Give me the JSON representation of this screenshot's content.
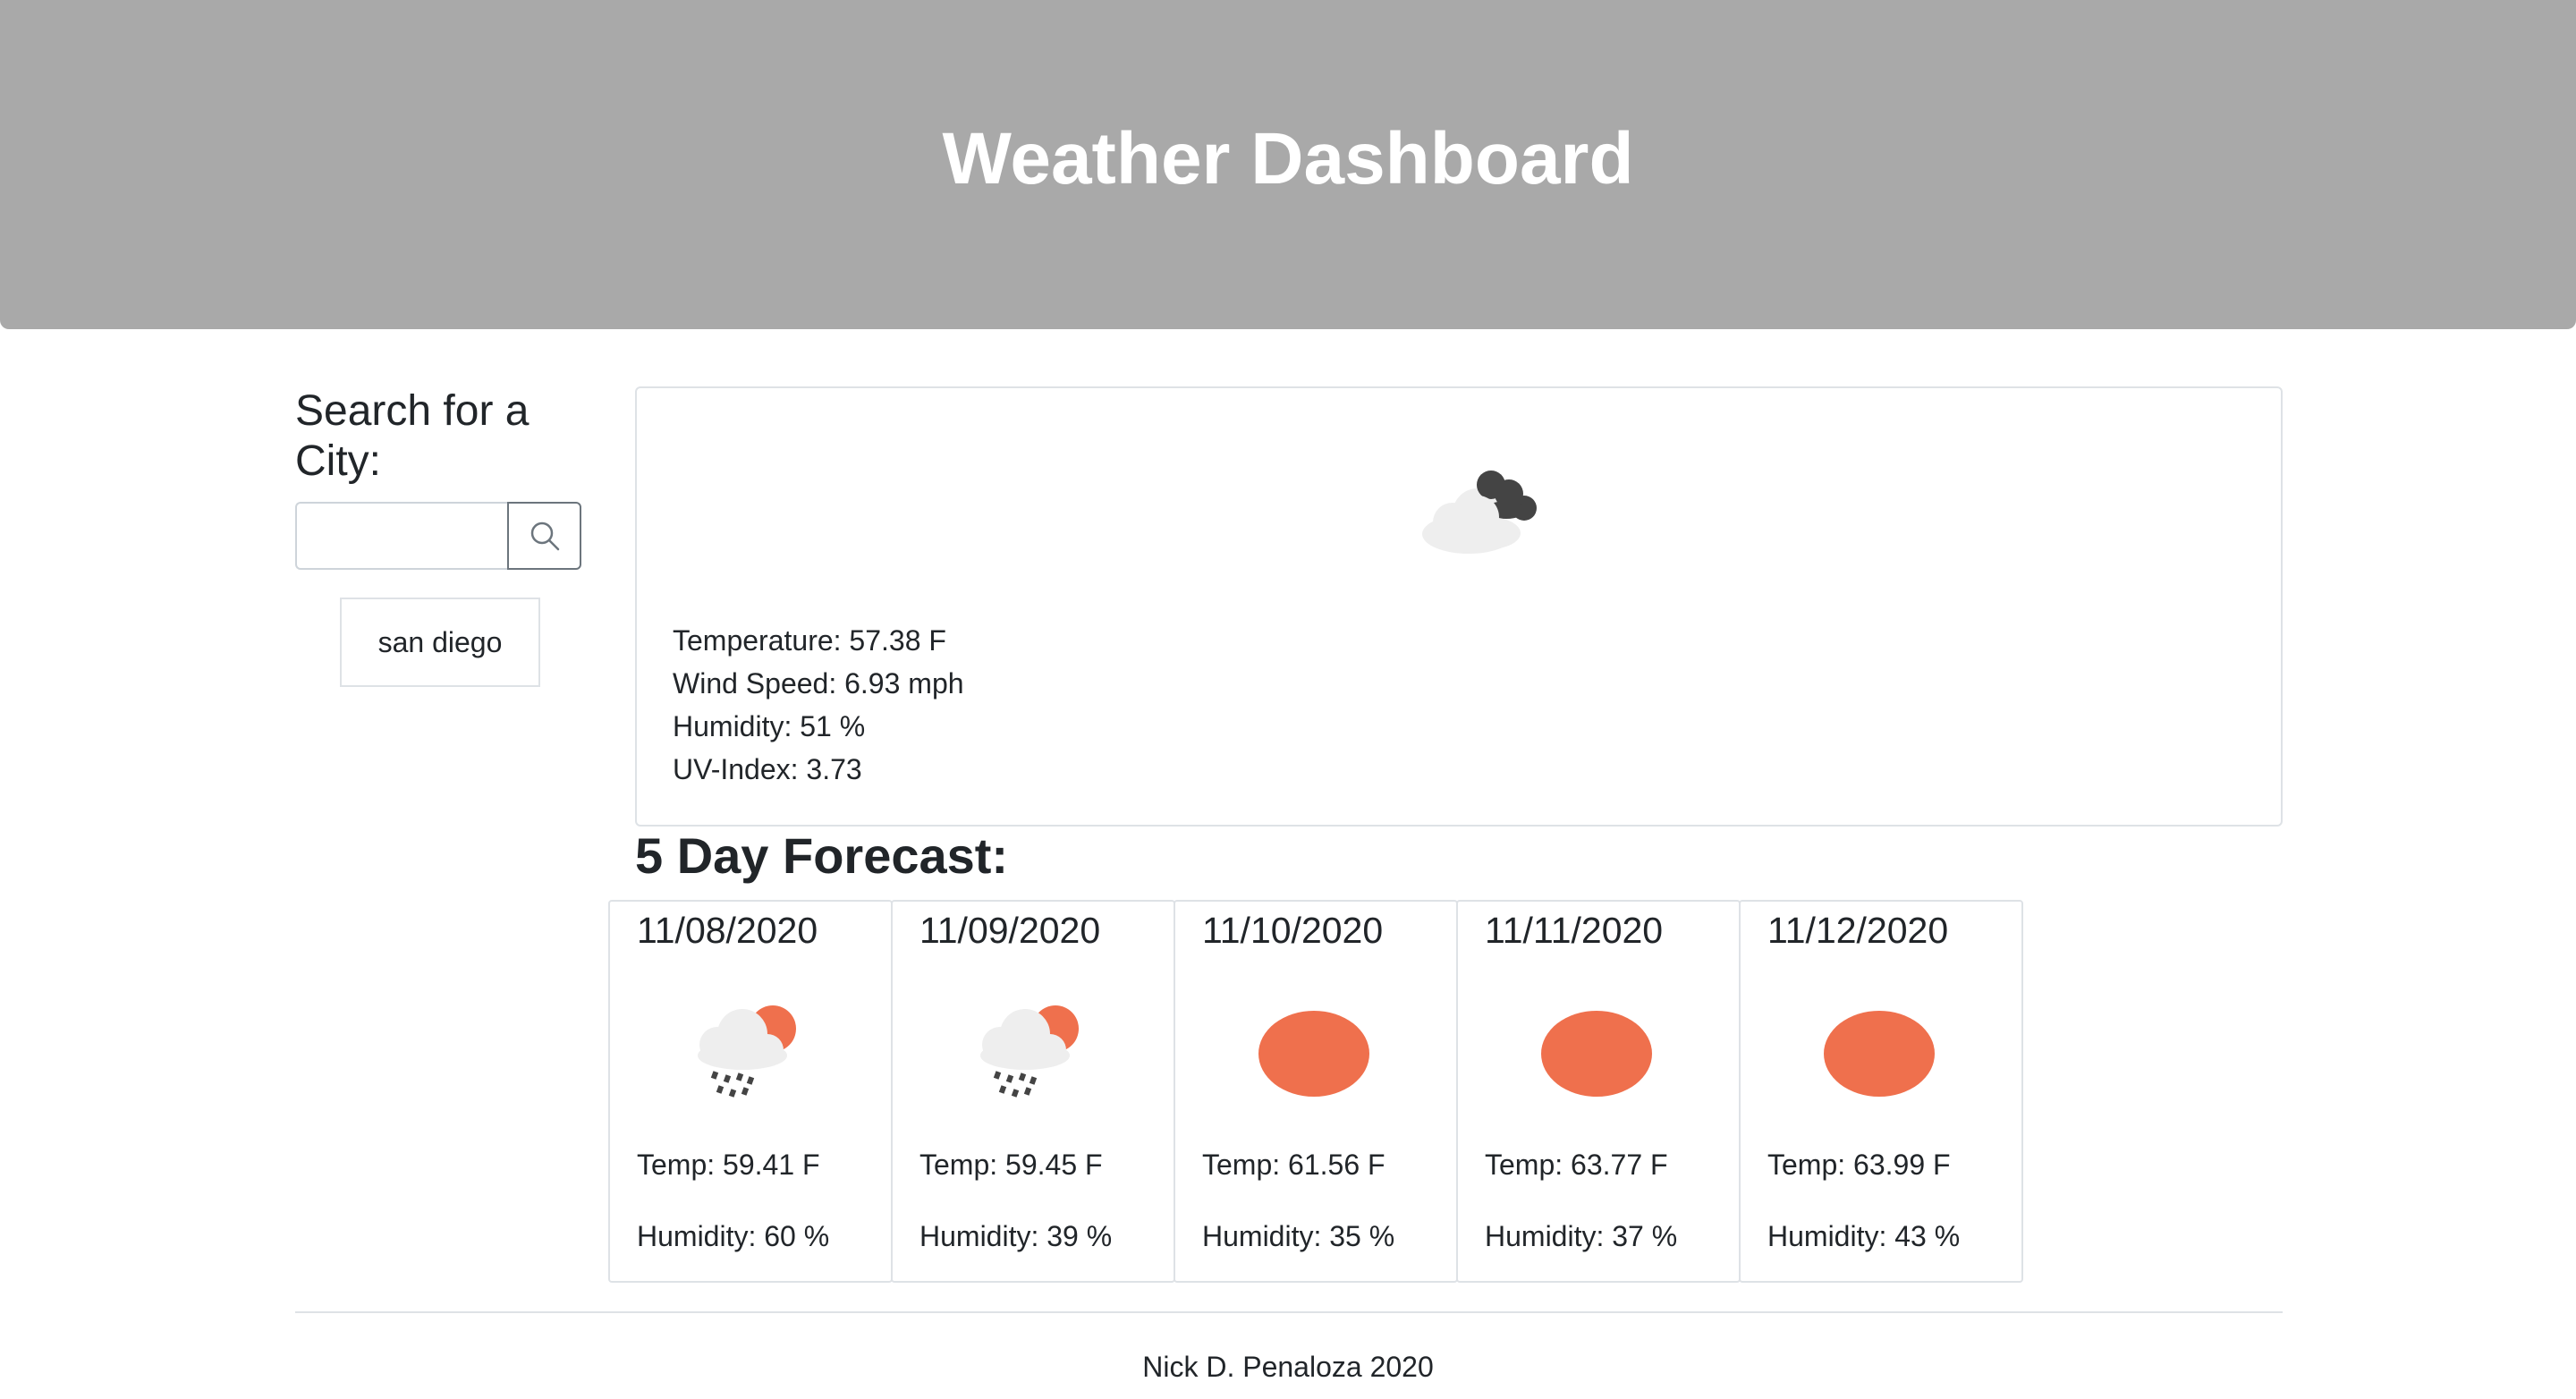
{
  "header": {
    "title": "Weather Dashboard"
  },
  "search": {
    "title": "Search for a City:",
    "input_value": "",
    "button_icon": "search-icon",
    "history": [
      "san diego"
    ]
  },
  "current": {
    "icon": "overcast-clouds-icon",
    "temperature": "Temperature: 57.38 F",
    "wind": "Wind Speed: 6.93 mph",
    "humidity": "Humidity: 51 %",
    "uv": "UV-Index: 3.73"
  },
  "forecast": {
    "title": "5 Day Forecast:",
    "days": [
      {
        "date": "11/08/2020",
        "icon": "rain-sun-icon",
        "temp": "Temp: 59.41 F",
        "humidity": "Humidity: 60 %"
      },
      {
        "date": "11/09/2020",
        "icon": "rain-sun-icon",
        "temp": "Temp: 59.45 F",
        "humidity": "Humidity: 39 %"
      },
      {
        "date": "11/10/2020",
        "icon": "sun-icon",
        "temp": "Temp: 61.56 F",
        "humidity": "Humidity: 35 %"
      },
      {
        "date": "11/11/2020",
        "icon": "sun-icon",
        "temp": "Temp: 63.77 F",
        "humidity": "Humidity: 37 %"
      },
      {
        "date": "11/12/2020",
        "icon": "sun-icon",
        "temp": "Temp: 63.99 F",
        "humidity": "Humidity: 43 %"
      }
    ]
  },
  "colors": {
    "header_bg": "#a9a9a9",
    "sun": "#ef704d",
    "cloud_light": "#eeeeee",
    "cloud_dark": "#444444"
  },
  "footer": {
    "text": "Nick D. Penaloza 2020"
  }
}
